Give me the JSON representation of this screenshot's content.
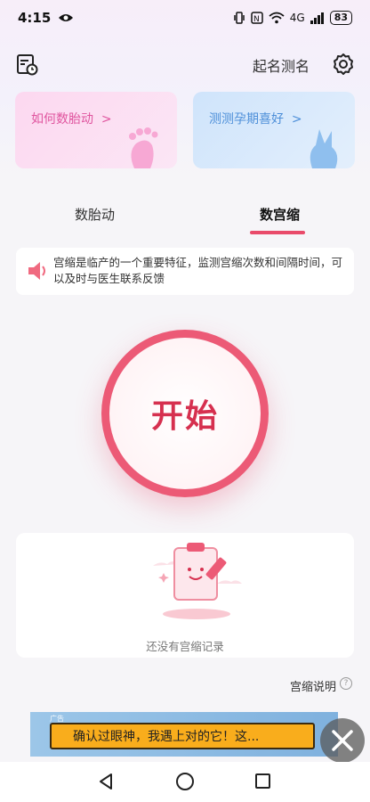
{
  "status": {
    "time": "4:15",
    "battery": "83",
    "network": "4G"
  },
  "header": {
    "title": "起名测名"
  },
  "cards": [
    {
      "label": "如何数胎动",
      "arrow": ">"
    },
    {
      "label": "测测孕期喜好",
      "arrow": ">"
    }
  ],
  "tabs": [
    {
      "label": "数胎动",
      "active": false
    },
    {
      "label": "数宫缩",
      "active": true
    }
  ],
  "info": {
    "text": "宫缩是临产的一个重要特征，监测宫缩次数和间隔时间，可以及时与医生联系反馈"
  },
  "start": {
    "label": "开始"
  },
  "records": {
    "empty_text": "还没有宫缩记录"
  },
  "explain": {
    "label": "宫缩说明",
    "help": "?"
  },
  "ad": {
    "tag": "广告",
    "text": "确认过眼神，我遇上对的它！这..."
  },
  "colors": {
    "accent": "#e94b6a",
    "pink_card": "#fcd8f0",
    "blue_card": "#cfe4fb",
    "ad_banner": "#f9ad1c"
  }
}
